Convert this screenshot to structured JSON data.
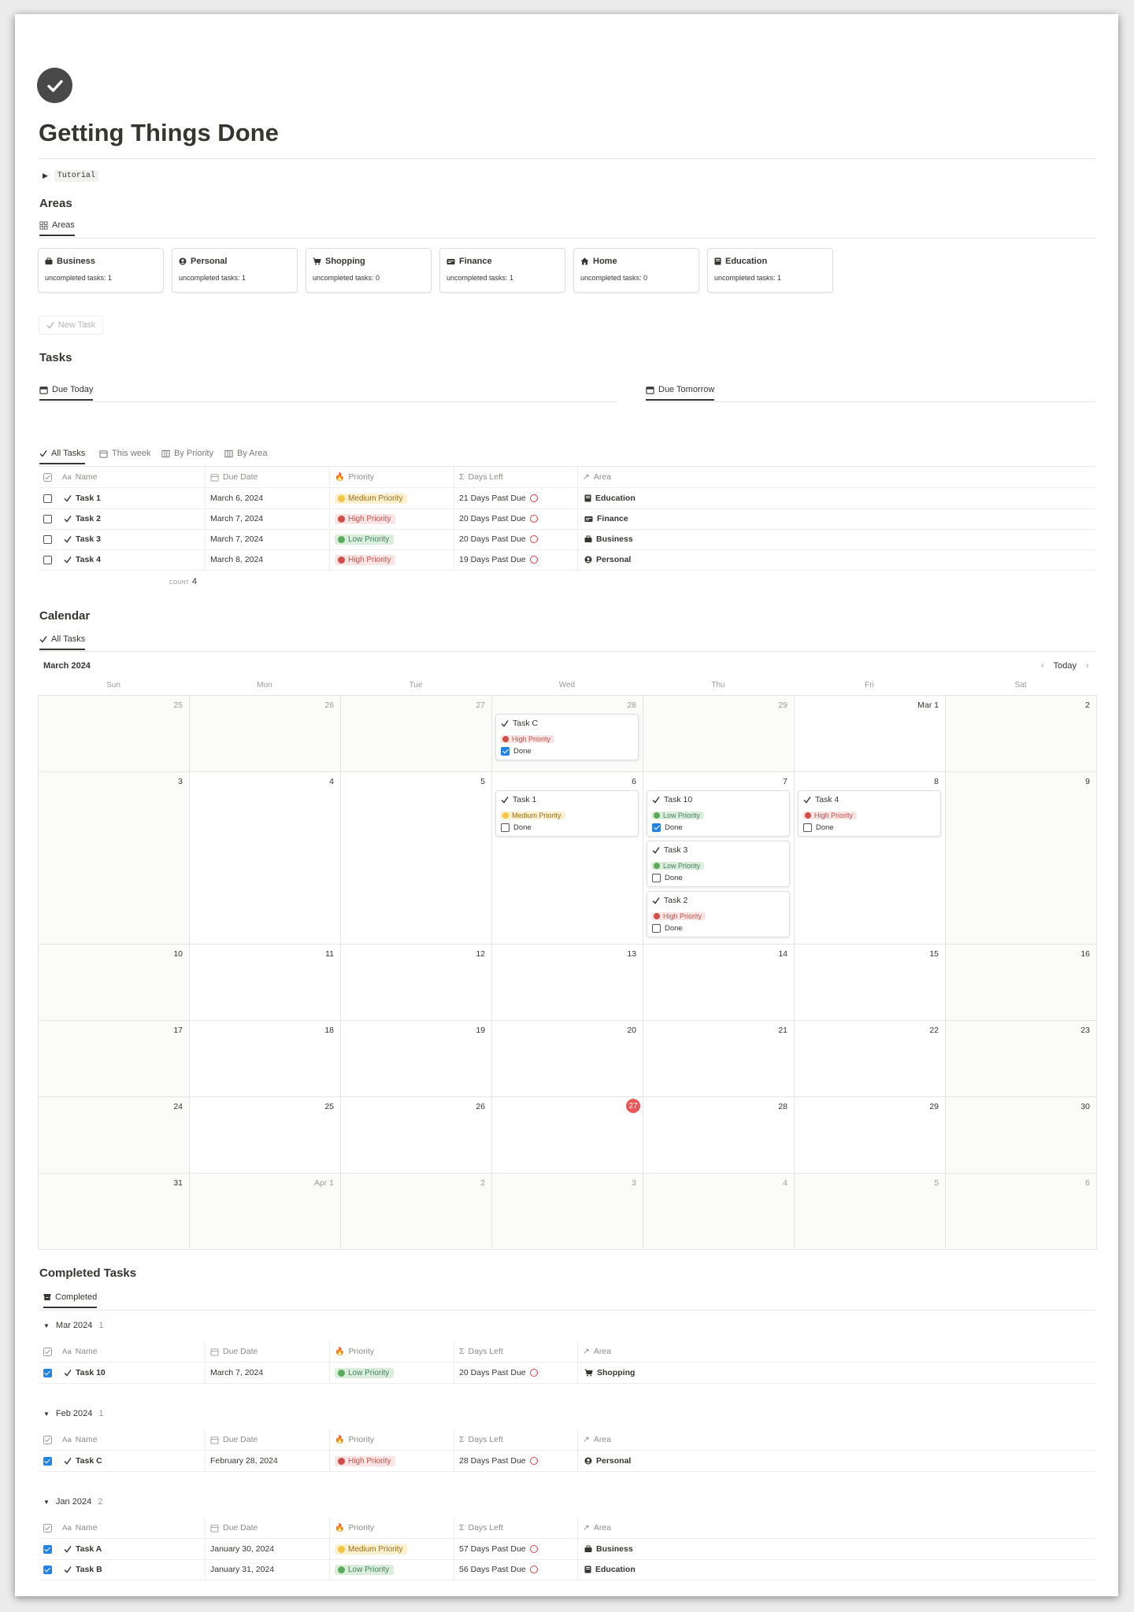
{
  "page": {
    "title": "Getting Things Done",
    "toggle_label": "Tutorial"
  },
  "areas": {
    "heading": "Areas",
    "tab": "Areas",
    "cards": [
      {
        "name": "Business",
        "icon": "briefcase-icon",
        "stat": "uncompleted tasks: 1"
      },
      {
        "name": "Personal",
        "icon": "person-icon",
        "stat": "uncompleted tasks: 1"
      },
      {
        "name": "Shopping",
        "icon": "cart-icon",
        "stat": "uncompleted tasks: 0"
      },
      {
        "name": "Finance",
        "icon": "money-icon",
        "stat": "uncompleted tasks: 1"
      },
      {
        "name": "Home",
        "icon": "home-icon",
        "stat": "uncompleted tasks: 0"
      },
      {
        "name": "Education",
        "icon": "book-icon",
        "stat": "uncompleted tasks: 1"
      }
    ],
    "new_task": "New Task"
  },
  "tasks": {
    "heading": "Tasks",
    "due_today": "Due Today",
    "due_tomorrow": "Due Tomorrow",
    "view_tabs": [
      "All Tasks",
      "This week",
      "By Priority",
      "By Area"
    ],
    "columns": {
      "name": "Name",
      "due": "Due Date",
      "priority": "Priority",
      "days": "Days Left",
      "area": "Area",
      "name_prefix": "Aa"
    },
    "rows": [
      {
        "name": "Task 1",
        "due": "March 6, 2024",
        "priority": "Medium Priority",
        "level": "med",
        "days": "21 Days Past Due",
        "area": "Education"
      },
      {
        "name": "Task 2",
        "due": "March 7, 2024",
        "priority": "High Priority",
        "level": "high",
        "days": "20 Days Past Due",
        "area": "Finance"
      },
      {
        "name": "Task 3",
        "due": "March 7, 2024",
        "priority": "Low Priority",
        "level": "low",
        "days": "20 Days Past Due",
        "area": "Business"
      },
      {
        "name": "Task 4",
        "due": "March 8, 2024",
        "priority": "High Priority",
        "level": "high",
        "days": "19 Days Past Due",
        "area": "Personal"
      }
    ],
    "count_label": "COUNT",
    "count_value": "4"
  },
  "calendar": {
    "heading": "Calendar",
    "tab": "All Tasks",
    "month": "March 2024",
    "today_label": "Today",
    "weekdays": [
      "Sun",
      "Mon",
      "Tue",
      "Wed",
      "Thu",
      "Fri",
      "Sat"
    ],
    "weeks": [
      [
        "25",
        "26",
        "27",
        "28",
        "29",
        "Mar 1",
        "2"
      ],
      [
        "3",
        "4",
        "5",
        "6",
        "7",
        "8",
        "9"
      ],
      [
        "10",
        "11",
        "12",
        "13",
        "14",
        "15",
        "16"
      ],
      [
        "17",
        "18",
        "19",
        "20",
        "21",
        "22",
        "23"
      ],
      [
        "24",
        "25",
        "26",
        "27",
        "28",
        "29",
        "30"
      ],
      [
        "31",
        "Apr 1",
        "2",
        "3",
        "4",
        "5",
        "6"
      ]
    ],
    "today": "27",
    "done_label": "Done",
    "events": [
      {
        "name": "Task C",
        "priority": "High Priority",
        "level": "high",
        "done": true
      },
      {
        "name": "Task 1",
        "priority": "Medium Priority",
        "level": "med",
        "done": false
      },
      {
        "name": "Task 10",
        "priority": "Low Priority",
        "level": "low",
        "done": true
      },
      {
        "name": "Task 3",
        "priority": "Low Priority",
        "level": "low",
        "done": false
      },
      {
        "name": "Task 2",
        "priority": "High Priority",
        "level": "high",
        "done": false
      },
      {
        "name": "Task 4",
        "priority": "High Priority",
        "level": "high",
        "done": false
      }
    ]
  },
  "completed": {
    "heading": "Completed Tasks",
    "tab": "Completed",
    "groups": [
      {
        "label": "Mar 2024",
        "count": "1",
        "rows": [
          {
            "name": "Task 10",
            "due": "March 7, 2024",
            "priority": "Low Priority",
            "level": "low",
            "days": "20 Days Past Due",
            "area": "Shopping"
          }
        ]
      },
      {
        "label": "Feb 2024",
        "count": "1",
        "rows": [
          {
            "name": "Task C",
            "due": "February 28, 2024",
            "priority": "High Priority",
            "level": "high",
            "days": "28 Days Past Due",
            "area": "Personal"
          }
        ]
      },
      {
        "label": "Jan 2024",
        "count": "2",
        "rows": [
          {
            "name": "Task A",
            "due": "January 30, 2024",
            "priority": "Medium Priority",
            "level": "med",
            "days": "57 Days Past Due",
            "area": "Business"
          },
          {
            "name": "Task B",
            "due": "January 31, 2024",
            "priority": "Low Priority",
            "level": "low",
            "days": "56 Days Past Due",
            "area": "Education"
          }
        ]
      }
    ]
  },
  "colors": {
    "accent_blue": "#2383e2",
    "today_red": "#eb5757",
    "due_ring": "#e03e3e"
  }
}
